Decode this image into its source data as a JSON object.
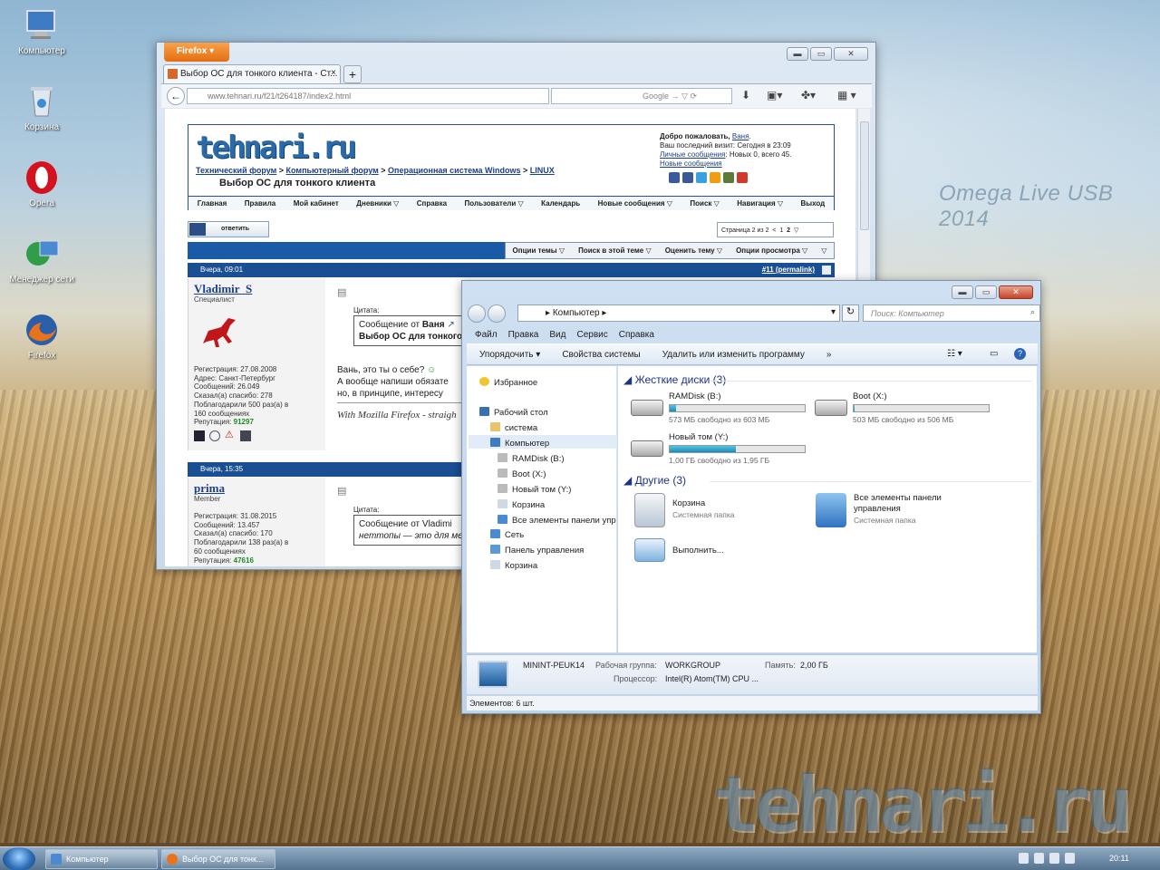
{
  "desktop": {
    "watermark_top": "Omega Live USB 2014",
    "watermark_bottom": "tehnari.ru",
    "icons": [
      {
        "label": "Компьютер",
        "icon": "computer-icon"
      },
      {
        "label": "Корзина",
        "icon": "recycle-bin-icon"
      },
      {
        "label": "Opera",
        "icon": "opera-icon"
      },
      {
        "label": "Менеджер сети",
        "icon": "network-manager-icon"
      },
      {
        "label": "Firefox",
        "icon": "firefox-icon"
      }
    ]
  },
  "firefox": {
    "menu_button": "Firefox",
    "tab_title": "Выбор ОС для тонкого клиента - Ст...",
    "tab_close": "×",
    "new_tab": "+",
    "url": "www.tehnari.ru/f21/t264187/index2.html",
    "search_engine": "Google",
    "site": {
      "logo": "tehnari.ru",
      "breadcrumb": [
        "Технический форум",
        "Компьютерный форум",
        "Операционная система Windows",
        "LINUX"
      ],
      "thread_title": "Выбор ОС для тонкого клиента",
      "welcome_line1": "Добро пожаловать,",
      "welcome_user": "Ваня",
      "welcome_line2": "Ваш последний визит: Сегодня в 23:09",
      "welcome_pm": "Личные сообщения",
      "welcome_pm_rest": ": Новых 0, всего 45.",
      "welcome_new": "Новые сообщения",
      "menu": [
        "Главная",
        "Правила",
        "Мой кабинет",
        "Дневники ▽",
        "Справка",
        "Пользователи ▽",
        "Календарь",
        "Новые сообщения ▽",
        "Поиск ▽",
        "Навигация ▽",
        "Выход"
      ],
      "reply_button": "ответить",
      "pager": [
        "Страница 2 из 2",
        "<",
        "1",
        "2",
        "▽"
      ],
      "thread_options": [
        "Опции темы ▽",
        "Поиск в этой теме ▽",
        "Оценить тему ▽",
        "Опции просмотра ▽",
        "▽"
      ],
      "posts": [
        {
          "date": "Вчера, 09:01",
          "permalink_num": "#11",
          "permalink": "(permalink)",
          "user": "Vladimir_S",
          "role": "Специалист",
          "stats": [
            "Регистрация: 27.08.2008",
            "Адрес: Санкт-Петербург",
            "Сообщений: 26.049",
            "Сказал(а) спасибо: 278",
            "Поблагодарили 500 раз(а) в",
            "160 сообщениях"
          ],
          "rep_label": "Репутация:",
          "rep": "91297",
          "quote_label": "Цитата:",
          "quote_line1": "Сообщение от Ваня",
          "quote_line2": "Выбор ОС для тонкого",
          "text": [
            "Вань, это ты о себе?",
            "А вообще напиши обязате",
            "но, в принципе, интересу"
          ],
          "signature": "With Mozilla Firefox - straigh"
        },
        {
          "date": "Вчера, 15:35",
          "user": "prima",
          "role": "Member",
          "stats": [
            "Регистрация: 31.08.2015",
            "Сообщений: 13.457",
            "Сказал(а) спасибо: 170",
            "Поблагодарили 138 раз(а) в",
            "60 сообщениях"
          ],
          "rep_label": "Репутация:",
          "rep": "47616",
          "quote_label": "Цитата:",
          "quote_line1": "Сообщение от Vladimi",
          "quote_line2": "неттопы — это для ме"
        }
      ]
    }
  },
  "explorer": {
    "address": "Компьютер",
    "search_placeholder": "Поиск: Компьютер",
    "menu": [
      "Файл",
      "Правка",
      "Вид",
      "Сервис",
      "Справка"
    ],
    "commands": [
      "Упорядочить ▾",
      "Свойства системы",
      "Удалить или изменить программу",
      "»"
    ],
    "nav": {
      "favorites": "Избранное",
      "desktop": "Рабочий стол",
      "system": "система",
      "computer": "Компьютер",
      "ramdisk": "RAMDisk (B:)",
      "boot": "Boot (X:)",
      "newvol": "Новый том (Y:)",
      "recycle": "Корзина",
      "allcp": "Все элементы панели упр",
      "network": "Сеть",
      "cpanel": "Панель управления",
      "recycle2": "Корзина"
    },
    "groups": {
      "hdd": "Жесткие диски (3)",
      "other": "Другие (3)"
    },
    "drives": [
      {
        "name": "RAMDisk (B:)",
        "free": "573 МБ свободно из 603 МБ",
        "used_fraction": 0.05
      },
      {
        "name": "Boot (X:)",
        "free": "503 МБ свободно из 506 МБ",
        "used_fraction": 0.01
      },
      {
        "name": "Новый том (Y:)",
        "free": "1,00 ГБ свободно из 1,95 ГБ",
        "used_fraction": 0.49
      }
    ],
    "others": [
      {
        "name": "Корзина",
        "sub": "Системная папка"
      },
      {
        "name": "Все элементы панели управления",
        "sub": "Системная папка"
      },
      {
        "name": "Выполнить...",
        "sub": ""
      }
    ],
    "details": {
      "pc_name": "MININT-PEUK14",
      "workgroup_label": "Рабочая группа:",
      "workgroup": "WORKGROUP",
      "memory_label": "Память:",
      "memory": "2,00 ГБ",
      "cpu_label": "Процессор:",
      "cpu": "Intel(R) Atom(TM) CPU ..."
    },
    "status": "Элементов: 6 шт."
  },
  "taskbar": {
    "buttons": [
      "Компьютер",
      "Выбор ОС для тонк..."
    ],
    "clock": "20:11"
  }
}
